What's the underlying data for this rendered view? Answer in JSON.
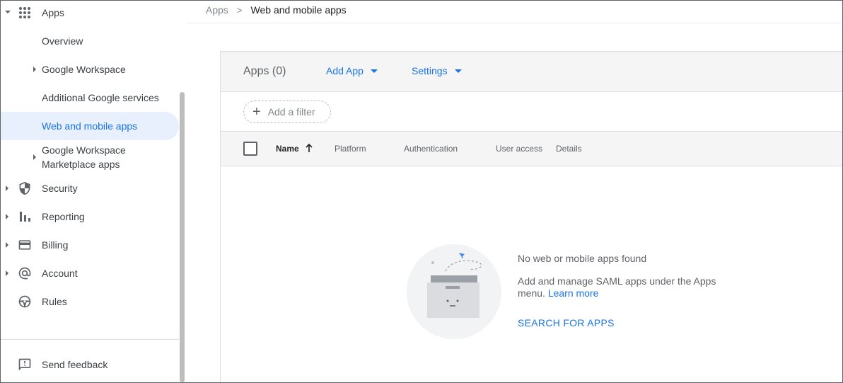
{
  "breadcrumb": {
    "root": "Apps",
    "separator": ">",
    "current": "Web and mobile apps"
  },
  "sidebar": {
    "items": [
      {
        "label": "Apps",
        "icon": "apps-grid-icon"
      },
      {
        "label": "Overview"
      },
      {
        "label": "Google Workspace"
      },
      {
        "label": "Additional Google services"
      },
      {
        "label": "Web and mobile apps"
      },
      {
        "label_line1": "Google Workspace",
        "label_line2": "Marketplace apps"
      },
      {
        "label": "Security",
        "icon": "shield-icon"
      },
      {
        "label": "Reporting",
        "icon": "bar-chart-icon"
      },
      {
        "label": "Billing",
        "icon": "credit-card-icon"
      },
      {
        "label": "Account",
        "icon": "at-sign-icon"
      },
      {
        "label": "Rules",
        "icon": "steering-wheel-icon"
      }
    ],
    "feedback": {
      "label": "Send feedback",
      "icon": "feedback-icon"
    }
  },
  "toolbar": {
    "apps_count": "Apps (0)",
    "add_app": "Add App",
    "settings": "Settings"
  },
  "filter": {
    "label": "Add a filter"
  },
  "table": {
    "columns": [
      "Name",
      "Platform",
      "Authentication",
      "User access",
      "Details"
    ]
  },
  "empty_state": {
    "title": "No web or mobile apps found",
    "description": "Add and manage SAML apps under the Apps menu.",
    "learn_more": "Learn more",
    "action": "SEARCH FOR APPS"
  },
  "colors": {
    "accent": "#1a73e8",
    "active_bg": "#e8f0fe",
    "toolbar_bg": "#f5f5f5"
  }
}
